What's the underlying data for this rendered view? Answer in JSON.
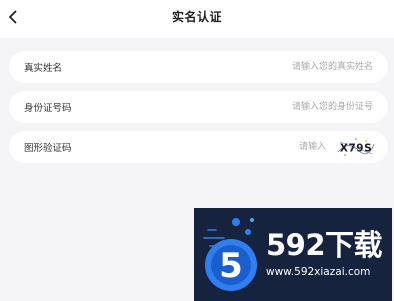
{
  "header": {
    "title": "实名认证",
    "back_icon": "chevron-left-icon"
  },
  "form": {
    "real_name": {
      "label": "真实姓名",
      "placeholder": "请输入您的真实姓名",
      "value": ""
    },
    "id_number": {
      "label": "身份证号码",
      "placeholder": "请输入您的身份证号",
      "value": ""
    },
    "captcha": {
      "label": "图形验证码",
      "placeholder": "请输入",
      "value": "",
      "image_text": "X79S"
    }
  },
  "watermark": {
    "logo_glyph": "5",
    "brand": "592下载",
    "url": "www.592xiazai.com"
  },
  "colors": {
    "background": "#f5f5f7",
    "card": "#ffffff",
    "watermark_bg": "#15233f",
    "watermark_accent": "#2f7ff0"
  }
}
